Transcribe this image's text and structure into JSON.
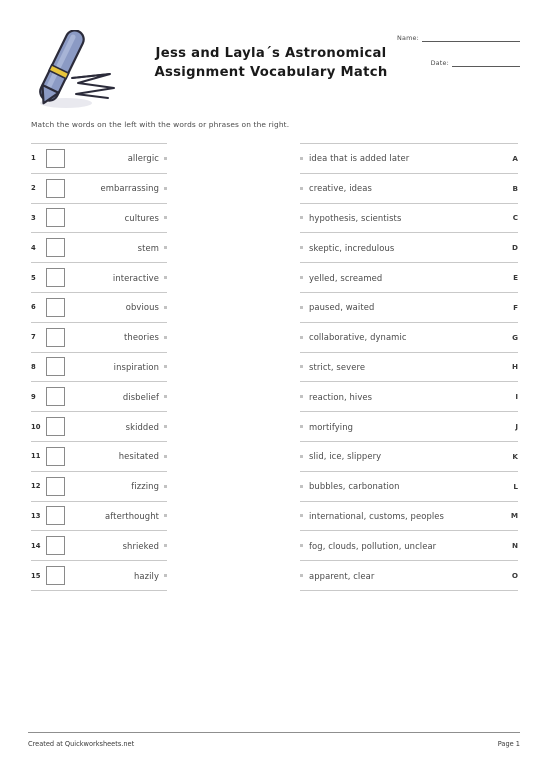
{
  "header": {
    "title_line1": "Jess and Layla´s Astronomical",
    "title_line2": "Assignment Vocabulary Match",
    "name_label": "Name:",
    "date_label": "Date:",
    "pen_icon": "fountain-pen-icon"
  },
  "instructions": "Match the words on the left with the words or phrases on the right.",
  "left_column": [
    {
      "number": "1",
      "word": "allergic"
    },
    {
      "number": "2",
      "word": "embarrassing"
    },
    {
      "number": "3",
      "word": "cultures"
    },
    {
      "number": "4",
      "word": "stem"
    },
    {
      "number": "5",
      "word": "interactive"
    },
    {
      "number": "6",
      "word": "obvious"
    },
    {
      "number": "7",
      "word": "theories"
    },
    {
      "number": "8",
      "word": "inspiration"
    },
    {
      "number": "9",
      "word": "disbelief"
    },
    {
      "number": "10",
      "word": "skidded"
    },
    {
      "number": "11",
      "word": "hesitated"
    },
    {
      "number": "12",
      "word": "fizzing"
    },
    {
      "number": "13",
      "word": "afterthought"
    },
    {
      "number": "14",
      "word": "shrieked"
    },
    {
      "number": "15",
      "word": "hazily"
    }
  ],
  "right_column": [
    {
      "letter": "A",
      "definition": "idea that is added later"
    },
    {
      "letter": "B",
      "definition": "creative, ideas"
    },
    {
      "letter": "C",
      "definition": "hypothesis, scientists"
    },
    {
      "letter": "D",
      "definition": "skeptic, incredulous"
    },
    {
      "letter": "E",
      "definition": "yelled, screamed"
    },
    {
      "letter": "F",
      "definition": "paused, waited"
    },
    {
      "letter": "G",
      "definition": "collaborative, dynamic"
    },
    {
      "letter": "H",
      "definition": "strict, severe"
    },
    {
      "letter": "I",
      "definition": "reaction, hives"
    },
    {
      "letter": "J",
      "definition": "mortifying"
    },
    {
      "letter": "K",
      "definition": "slid, ice, slippery"
    },
    {
      "letter": "L",
      "definition": "bubbles, carbonation"
    },
    {
      "letter": "M",
      "definition": "international, customs, peoples"
    },
    {
      "letter": "N",
      "definition": "fog, clouds, pollution, unclear"
    },
    {
      "letter": "O",
      "definition": "apparent, clear"
    }
  ],
  "footer": {
    "credit": "Created at Quickworksheets.net",
    "page": "Page 1"
  },
  "colors": {
    "pen_body": "#8b9ac4",
    "pen_body_light": "#a7b4d6",
    "pen_band": "#e8c53a",
    "pen_outline": "#2b2b3a",
    "rule_light": "#c9c9c9",
    "rule_dark": "#8f8f8f",
    "dot": "#c2c2c2",
    "box_border": "#8a8a8a",
    "text": "#4a4a4a"
  }
}
